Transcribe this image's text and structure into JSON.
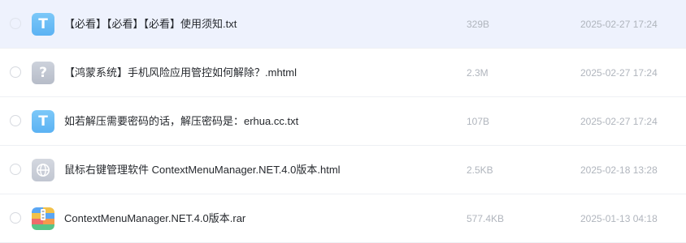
{
  "colors": {
    "highlight_row": "#eef2fd",
    "txt_icon": "#6bbdf6",
    "unknown_icon": "#c2c7d1",
    "html_icon": "#c9cdd7",
    "filename_text": "#26292e",
    "meta_text": "#b0b5bd"
  },
  "files": [
    {
      "name": "【必看】【必看】【必看】使用须知.txt",
      "size": "329B",
      "date": "2025-02-27 17:24",
      "icon": "txt-file-icon",
      "icon_glyph": "T",
      "highlighted": true
    },
    {
      "name": "【鸿蒙系统】手机风险应用管控如何解除？.mhtml",
      "size": "2.3M",
      "date": "2025-02-27 17:24",
      "icon": "unknown-file-icon",
      "icon_glyph": "?",
      "highlighted": false
    },
    {
      "name": "如若解压需要密码的话，解压密码是：erhua.cc.txt",
      "size": "107B",
      "date": "2025-02-27 17:24",
      "icon": "txt-file-icon",
      "icon_glyph": "T",
      "highlighted": false
    },
    {
      "name": "鼠标右键管理软件 ContextMenuManager.NET.4.0版本.html",
      "size": "2.5KB",
      "date": "2025-02-18 13:28",
      "icon": "html-file-icon",
      "icon_glyph": "",
      "highlighted": false
    },
    {
      "name": "ContextMenuManager.NET.4.0版本.rar",
      "size": "577.4KB",
      "date": "2025-01-13 04:18",
      "icon": "rar-archive-icon",
      "icon_glyph": "",
      "highlighted": false
    }
  ]
}
